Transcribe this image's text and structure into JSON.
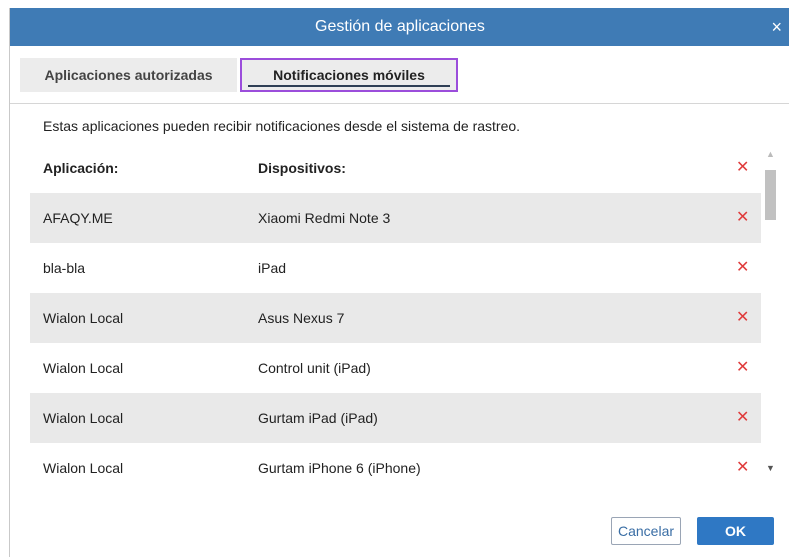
{
  "dialog": {
    "title": "Gestión de aplicaciones",
    "close_glyph": "×"
  },
  "tabs": [
    {
      "label": "Aplicaciones autorizadas",
      "active": false
    },
    {
      "label": "Notificaciones móviles",
      "active": true
    }
  ],
  "description": "Estas aplicaciones pueden recibir notificaciones desde el sistema de rastreo.",
  "table": {
    "headers": {
      "app": "Aplicación:",
      "devices": "Dispositivos:"
    },
    "delete_glyph": "✕",
    "rows": [
      {
        "app": "AFAQY.ME",
        "device": "Xiaomi Redmi Note 3"
      },
      {
        "app": "bla-bla",
        "device": "iPad"
      },
      {
        "app": "Wialon Local",
        "device": "Asus Nexus 7"
      },
      {
        "app": "Wialon Local",
        "device": "Control unit (iPad)"
      },
      {
        "app": "Wialon Local",
        "device": "Gurtam iPad (iPad)"
      },
      {
        "app": "Wialon Local",
        "device": "Gurtam iPhone 6 (iPhone)"
      }
    ]
  },
  "scrollbar": {
    "up_glyph": "▲",
    "down_glyph": "▼"
  },
  "buttons": {
    "cancel": "Cancelar",
    "ok": "OK"
  },
  "colors": {
    "titlebar": "#3f7bb5",
    "delete_icon": "#e03b3b",
    "ok_button": "#2f78c4",
    "active_tab_highlight": "#9b4ddb"
  }
}
